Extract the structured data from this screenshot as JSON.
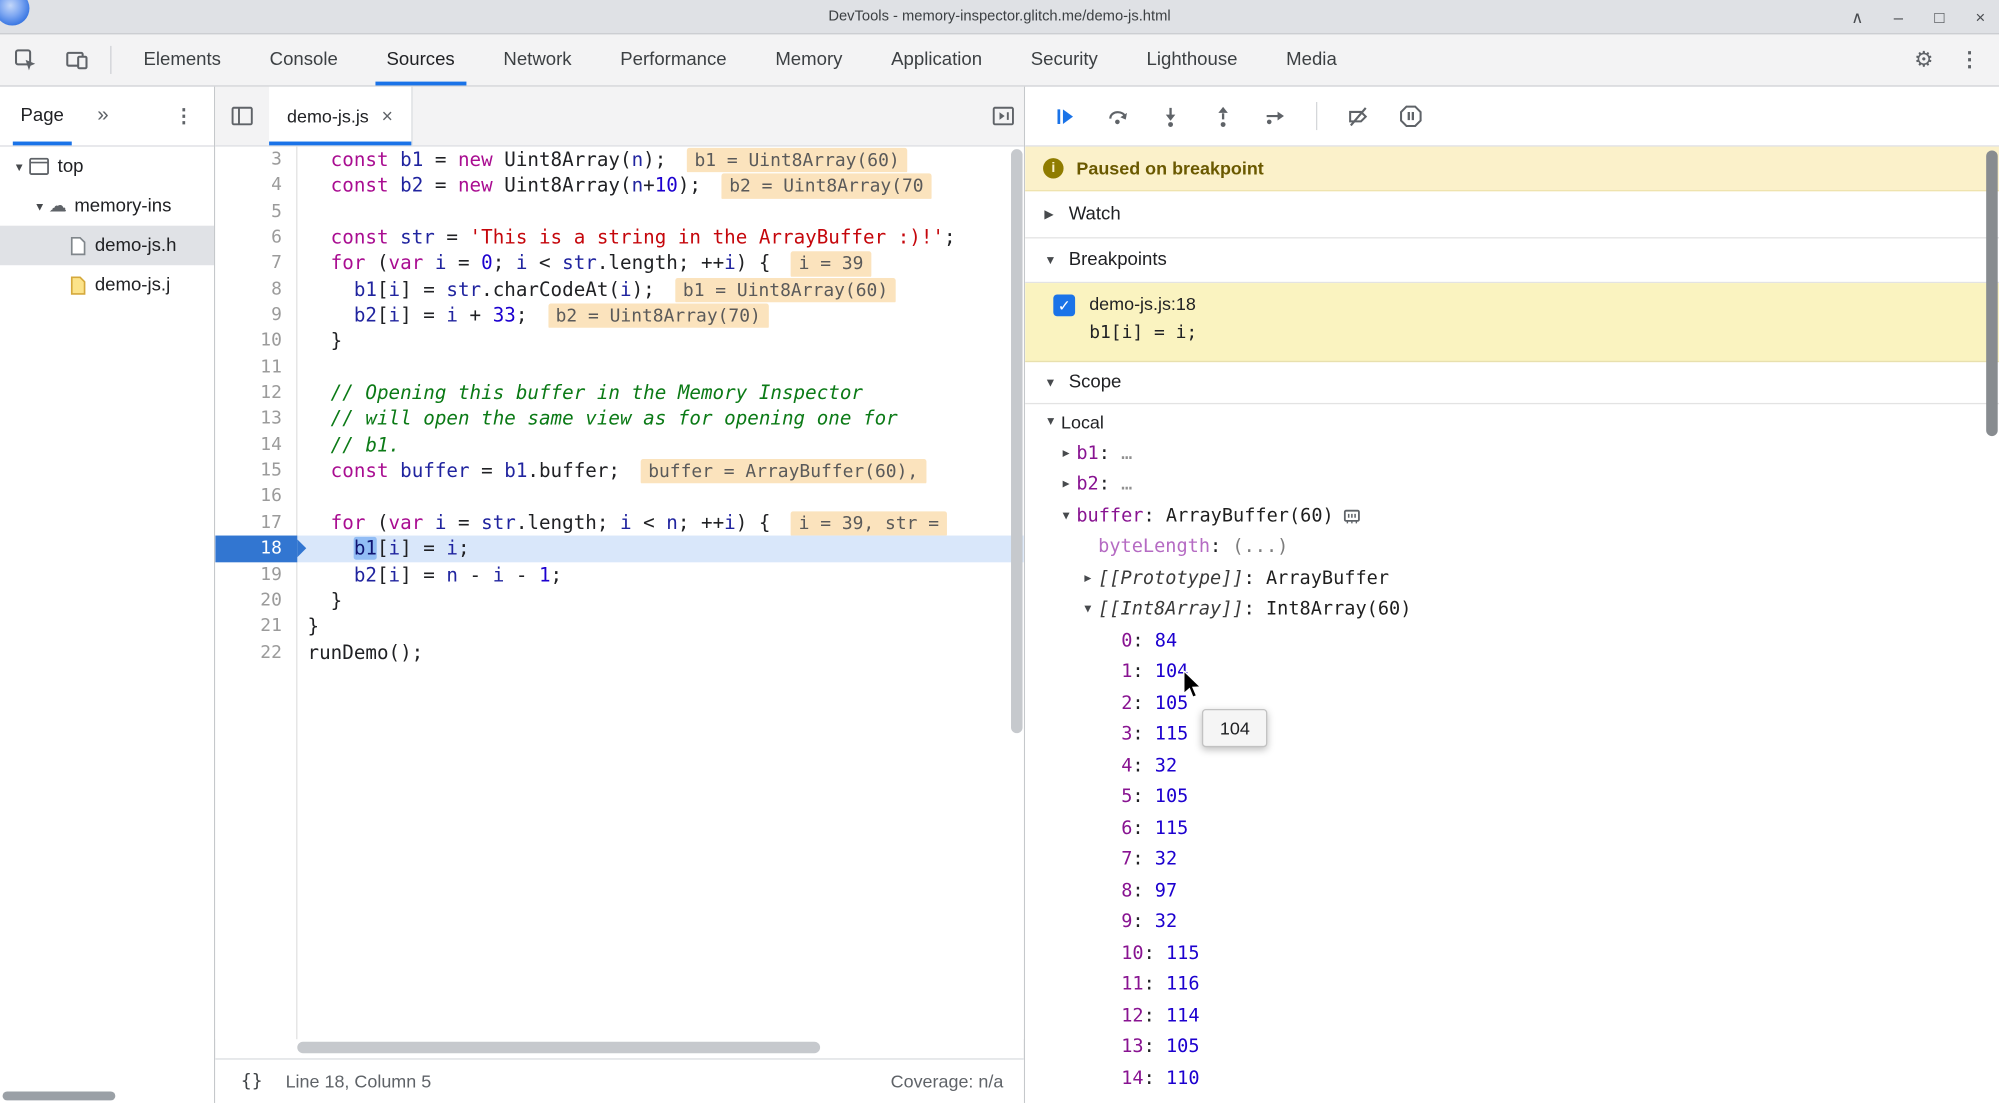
{
  "window": {
    "title": "DevTools - memory-inspector.glitch.me/demo-js.html",
    "controls": [
      "collapse",
      "minimize",
      "maximize",
      "close"
    ]
  },
  "toolbar": {
    "tabs": [
      "Elements",
      "Console",
      "Sources",
      "Network",
      "Performance",
      "Memory",
      "Application",
      "Security",
      "Lighthouse",
      "Media"
    ],
    "active_tab": "Sources",
    "left_icons": [
      "inspect-element",
      "device-toolbar"
    ],
    "right_icons": [
      "settings-gear",
      "more-options"
    ]
  },
  "navigator": {
    "tab_label": "Page",
    "tree": [
      {
        "label": "top",
        "lvl": 0,
        "icon": "frame",
        "arrow": "down"
      },
      {
        "label": "memory-ins",
        "lvl": 1,
        "icon": "cloud",
        "arrow": "down"
      },
      {
        "label": "demo-js.h",
        "lvl": 2,
        "icon": "file-html",
        "selected": true
      },
      {
        "label": "demo-js.j",
        "lvl": 2,
        "icon": "file-js"
      }
    ]
  },
  "editor": {
    "tab_label": "demo-js.js",
    "status": {
      "format_icon": "{}",
      "line_col": "Line 18, Column 5",
      "coverage": "Coverage: n/a"
    },
    "lines": [
      {
        "n": 3,
        "tok": [
          [
            "pl",
            "  "
          ],
          [
            "kw",
            "const"
          ],
          [
            "pl",
            " "
          ],
          [
            "vr",
            "b1"
          ],
          [
            "pl",
            " = "
          ],
          [
            "kw",
            "new"
          ],
          [
            "pl",
            " Uint8Array("
          ],
          [
            "vr",
            "n"
          ],
          [
            "pl",
            ");"
          ]
        ],
        "chip": "b1 = Uint8Array(60)"
      },
      {
        "n": 4,
        "tok": [
          [
            "pl",
            "  "
          ],
          [
            "kw",
            "const"
          ],
          [
            "pl",
            " "
          ],
          [
            "vr",
            "b2"
          ],
          [
            "pl",
            " = "
          ],
          [
            "kw",
            "new"
          ],
          [
            "pl",
            " Uint8Array("
          ],
          [
            "vr",
            "n"
          ],
          [
            "pl",
            "+"
          ],
          [
            "num",
            "10"
          ],
          [
            "pl",
            ");"
          ]
        ],
        "chip": "b2 = Uint8Array(70"
      },
      {
        "n": 5,
        "tok": []
      },
      {
        "n": 6,
        "tok": [
          [
            "pl",
            "  "
          ],
          [
            "kw",
            "const"
          ],
          [
            "pl",
            " "
          ],
          [
            "vr",
            "str"
          ],
          [
            "pl",
            " = "
          ],
          [
            "str",
            "'This is a string in the ArrayBuffer :)!'"
          ],
          [
            "pl",
            ";"
          ]
        ]
      },
      {
        "n": 7,
        "tok": [
          [
            "pl",
            "  "
          ],
          [
            "kw",
            "for"
          ],
          [
            "pl",
            " ("
          ],
          [
            "kw",
            "var"
          ],
          [
            "pl",
            " "
          ],
          [
            "vr",
            "i"
          ],
          [
            "pl",
            " = "
          ],
          [
            "num",
            "0"
          ],
          [
            "pl",
            "; "
          ],
          [
            "vr",
            "i"
          ],
          [
            "pl",
            " < "
          ],
          [
            "vr",
            "str"
          ],
          [
            "pl",
            ".length; ++"
          ],
          [
            "vr",
            "i"
          ],
          [
            "pl",
            ") {"
          ]
        ],
        "chip": "i = 39"
      },
      {
        "n": 8,
        "tok": [
          [
            "pl",
            "    "
          ],
          [
            "vr",
            "b1"
          ],
          [
            "pl",
            "["
          ],
          [
            "vr",
            "i"
          ],
          [
            "pl",
            "] = "
          ],
          [
            "vr",
            "str"
          ],
          [
            "pl",
            ".charCodeAt("
          ],
          [
            "vr",
            "i"
          ],
          [
            "pl",
            ");"
          ]
        ],
        "chip": "b1 = Uint8Array(60)"
      },
      {
        "n": 9,
        "tok": [
          [
            "pl",
            "    "
          ],
          [
            "vr",
            "b2"
          ],
          [
            "pl",
            "["
          ],
          [
            "vr",
            "i"
          ],
          [
            "pl",
            "] = "
          ],
          [
            "vr",
            "i"
          ],
          [
            "pl",
            " + "
          ],
          [
            "num",
            "33"
          ],
          [
            "pl",
            ";"
          ]
        ],
        "chip": "b2 = Uint8Array(70)"
      },
      {
        "n": 10,
        "tok": [
          [
            "pl",
            "  }"
          ]
        ]
      },
      {
        "n": 11,
        "tok": []
      },
      {
        "n": 12,
        "tok": [
          [
            "cmt",
            "  // Opening this buffer in the Memory Inspector"
          ]
        ]
      },
      {
        "n": 13,
        "tok": [
          [
            "cmt",
            "  // will open the same view as for opening one for"
          ]
        ]
      },
      {
        "n": 14,
        "tok": [
          [
            "cmt",
            "  // b1."
          ]
        ]
      },
      {
        "n": 15,
        "tok": [
          [
            "pl",
            "  "
          ],
          [
            "kw",
            "const"
          ],
          [
            "pl",
            " "
          ],
          [
            "vr",
            "buffer"
          ],
          [
            "pl",
            " = "
          ],
          [
            "vr",
            "b1"
          ],
          [
            "pl",
            ".buffer;"
          ]
        ],
        "chip": "buffer = ArrayBuffer(60),"
      },
      {
        "n": 16,
        "tok": []
      },
      {
        "n": 17,
        "tok": [
          [
            "pl",
            "  "
          ],
          [
            "kw",
            "for"
          ],
          [
            "pl",
            " ("
          ],
          [
            "kw",
            "var"
          ],
          [
            "pl",
            " "
          ],
          [
            "vr",
            "i"
          ],
          [
            "pl",
            " = "
          ],
          [
            "vr",
            "str"
          ],
          [
            "pl",
            ".length; "
          ],
          [
            "vr",
            "i"
          ],
          [
            "pl",
            " < "
          ],
          [
            "vr",
            "n"
          ],
          [
            "pl",
            "; ++"
          ],
          [
            "vr",
            "i"
          ],
          [
            "pl",
            ") {"
          ]
        ],
        "chip": "i = 39, str ="
      },
      {
        "n": 18,
        "cur": true,
        "tok": [
          [
            "pl",
            "    "
          ],
          [
            "sel",
            "b1"
          ],
          [
            "pl",
            "["
          ],
          [
            "vr",
            "i"
          ],
          [
            "pl",
            "] = "
          ],
          [
            "vr",
            "i"
          ],
          [
            "pl",
            ";"
          ]
        ]
      },
      {
        "n": 19,
        "tok": [
          [
            "pl",
            "    "
          ],
          [
            "vr",
            "b2"
          ],
          [
            "pl",
            "["
          ],
          [
            "vr",
            "i"
          ],
          [
            "pl",
            "] = "
          ],
          [
            "vr",
            "n"
          ],
          [
            "pl",
            " - "
          ],
          [
            "vr",
            "i"
          ],
          [
            "pl",
            " - "
          ],
          [
            "num",
            "1"
          ],
          [
            "pl",
            ";"
          ]
        ]
      },
      {
        "n": 20,
        "tok": [
          [
            "pl",
            "  }"
          ]
        ]
      },
      {
        "n": 21,
        "tok": [
          [
            "pl",
            "}"
          ]
        ]
      },
      {
        "n": 22,
        "tok": [
          [
            "pl",
            "runDemo();"
          ]
        ]
      }
    ]
  },
  "debugger": {
    "toolbar_icons": [
      "resume",
      "step-over",
      "step-into",
      "step-out",
      "step",
      "sep",
      "deactivate-breakpoints",
      "pause-on-exceptions"
    ],
    "paused_message": "Paused on breakpoint",
    "watch_label": "Watch",
    "breakpoints_label": "Breakpoints",
    "scope_label": "Scope",
    "breakpoint": {
      "checked": true,
      "location": "demo-js.js:18",
      "code": "b1[i] = i;"
    },
    "tooltip_value": "104"
  },
  "scope": {
    "rows": [
      {
        "lvl": 0,
        "arrow": "down",
        "name": "Local",
        "nc": "section"
      },
      {
        "lvl": 1,
        "arrow": "right",
        "name": "b1",
        "nc": "prop",
        "value": "…",
        "vc": "dots"
      },
      {
        "lvl": 1,
        "arrow": "right",
        "name": "b2",
        "nc": "prop",
        "value": "…",
        "vc": "dots"
      },
      {
        "lvl": 1,
        "arrow": "down",
        "name": "buffer",
        "nc": "prop",
        "value": "ArrayBuffer(60)",
        "vc": "obj",
        "icon": "memory"
      },
      {
        "lvl": 2,
        "name": "byteLength",
        "nc": "dim",
        "value": "(...)",
        "vc": "getter"
      },
      {
        "lvl": 2,
        "arrow": "right",
        "name": "[[Prototype]]",
        "nc": "internal",
        "value": "ArrayBuffer",
        "vc": "obj"
      },
      {
        "lvl": 2,
        "arrow": "down",
        "name": "[[Int8Array]]",
        "nc": "internal",
        "value": "Int8Array(60)",
        "vc": "obj"
      },
      {
        "lvl": 3,
        "name": "0",
        "nc": "prop",
        "value": "84",
        "vc": "num"
      },
      {
        "lvl": 3,
        "name": "1",
        "nc": "prop",
        "value": "104",
        "vc": "num"
      },
      {
        "lvl": 3,
        "name": "2",
        "nc": "prop",
        "value": "105",
        "vc": "num"
      },
      {
        "lvl": 3,
        "name": "3",
        "nc": "prop",
        "value": "115",
        "vc": "num"
      },
      {
        "lvl": 3,
        "name": "4",
        "nc": "prop",
        "value": "32",
        "vc": "num"
      },
      {
        "lvl": 3,
        "name": "5",
        "nc": "prop",
        "value": "105",
        "vc": "num"
      },
      {
        "lvl": 3,
        "name": "6",
        "nc": "prop",
        "value": "115",
        "vc": "num"
      },
      {
        "lvl": 3,
        "name": "7",
        "nc": "prop",
        "value": "32",
        "vc": "num"
      },
      {
        "lvl": 3,
        "name": "8",
        "nc": "prop",
        "value": "97",
        "vc": "num"
      },
      {
        "lvl": 3,
        "name": "9",
        "nc": "prop",
        "value": "32",
        "vc": "num"
      },
      {
        "lvl": 3,
        "name": "10",
        "nc": "prop",
        "value": "115",
        "vc": "num"
      },
      {
        "lvl": 3,
        "name": "11",
        "nc": "prop",
        "value": "116",
        "vc": "num"
      },
      {
        "lvl": 3,
        "name": "12",
        "nc": "prop",
        "value": "114",
        "vc": "num"
      },
      {
        "lvl": 3,
        "name": "13",
        "nc": "prop",
        "value": "105",
        "vc": "num"
      },
      {
        "lvl": 3,
        "name": "14",
        "nc": "prop",
        "value": "110",
        "vc": "num"
      }
    ]
  }
}
